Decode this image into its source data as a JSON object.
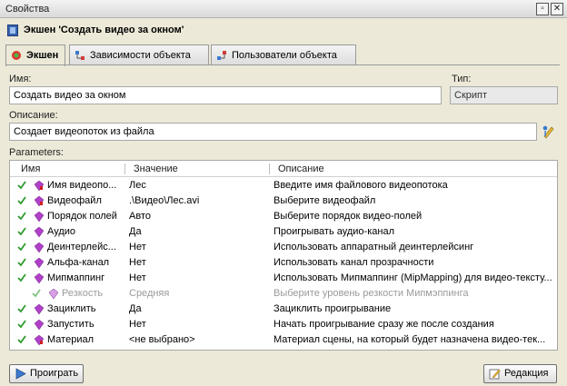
{
  "window": {
    "title": "Свойства"
  },
  "header": {
    "title": "Экшен 'Создать видео за окном'"
  },
  "tabs": [
    {
      "label": "Экшен"
    },
    {
      "label": "Зависимости объекта"
    },
    {
      "label": "Пользователи объекта"
    }
  ],
  "form": {
    "name_label": "Имя:",
    "name_value": "Создать видео за окном",
    "type_label": "Тип:",
    "type_value": "Скрипт",
    "desc_label": "Описание:",
    "desc_value": "Создает видеопоток из файла",
    "params_label": "Parameters:"
  },
  "grid": {
    "columns": [
      "Имя",
      "Значение",
      "Описание"
    ],
    "rows": [
      {
        "name": "Имя видеопо...",
        "value": "Лес",
        "desc": "Введите имя файлового видеопотока"
      },
      {
        "name": "Видеофайл",
        "value": ".\\Видео\\Лес.avi",
        "desc": "Выберите видеофайл"
      },
      {
        "name": "Порядок полей",
        "value": "Авто",
        "desc": "Выберите порядок видео-полей"
      },
      {
        "name": "Аудио",
        "value": "Да",
        "desc": "Проигрывать аудио-канал"
      },
      {
        "name": "Деинтерлейс...",
        "value": "Нет",
        "desc": "Использовать аппаратный деинтерлейсинг"
      },
      {
        "name": "Альфа-канал",
        "value": "Нет",
        "desc": "Использовать канал прозрачности"
      },
      {
        "name": "Мипмаппинг",
        "value": "Нет",
        "desc": "Использовать Мипмаппинг (MipMapping) для видео-тексту..."
      },
      {
        "name": "Резкость",
        "value": "Средняя",
        "desc": "Выберите уровень резкости Мипмэппинга"
      },
      {
        "name": "Зациклить",
        "value": "Да",
        "desc": "Зациклить проигрывание"
      },
      {
        "name": "Запустить",
        "value": "Нет",
        "desc": "Начать проигрывание сразу же после создания"
      },
      {
        "name": "Материал",
        "value": "<не выбрано>",
        "desc": "Материал сцены, на который будет назначена видео-тек..."
      }
    ]
  },
  "buttons": {
    "play": "Проиграть",
    "edit": "Редакция"
  },
  "colors": {
    "check": "#2e9a2e",
    "gem": "#b040c8",
    "accent_red": "#d02020",
    "dim_text": "#9a9a9a"
  }
}
